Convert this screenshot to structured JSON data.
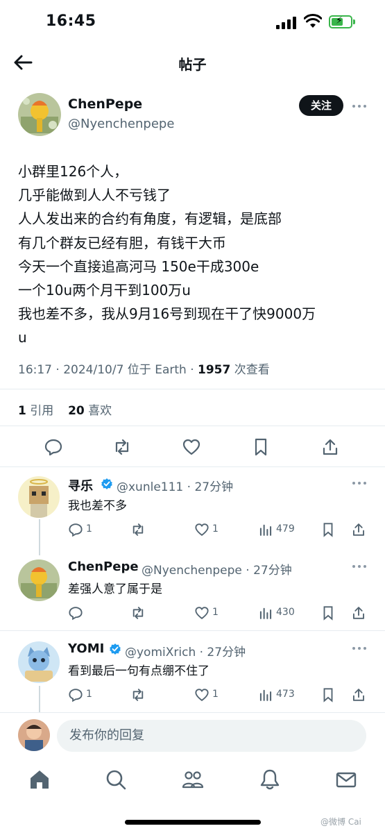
{
  "status_bar": {
    "time": "16:45"
  },
  "nav": {
    "title": "帖子"
  },
  "post": {
    "author_name": "ChenPepe",
    "author_handle": "@Nyenchenpepe",
    "follow_label": "关注",
    "lines": [
      "小群里126个人，",
      "几乎能做到人人不亏钱了",
      "人人发出来的合约有角度，有逻辑，是底部",
      "有几个群友已经有胆，有钱干大币",
      "今天一个直接追高河马 150e干成300e",
      "一个10u两个月干到100万u",
      "我也差不多，我从9月16号到现在干了快9000万",
      "u"
    ],
    "meta": {
      "time": "16:17",
      "date": "2024/10/7",
      "location": "位于 Earth",
      "views": "1957",
      "views_label": "次查看"
    },
    "stats": {
      "quotes": "1",
      "quotes_label": "引用",
      "likes": "20",
      "likes_label": "喜欢"
    }
  },
  "replies": [
    {
      "name": "寻乐",
      "verified": true,
      "handle": "@xunle111 · 27分钟",
      "text": "我也差不多",
      "replies": "1",
      "likes": "1",
      "views": "479"
    },
    {
      "name": "ChenPepe",
      "verified": false,
      "handle": "@Nyenchenpepe · 27分钟",
      "text": "差强人意了属于是",
      "replies": "",
      "likes": "1",
      "views": "430"
    },
    {
      "name": "YOMI",
      "verified": true,
      "handle": "@yomiXrich · 27分钟",
      "text": "看到最后一句有点绷不住了",
      "replies": "1",
      "likes": "1",
      "views": "473"
    }
  ],
  "compose": {
    "placeholder": "发布你的回复"
  },
  "tabs": [
    "home-icon",
    "search-icon",
    "communities-icon",
    "notifications-icon",
    "messages-icon"
  ],
  "watermark": "@微博 Cai",
  "colors": {
    "accent": "#1d9bf0",
    "text": "#0f1419",
    "muted": "#536471",
    "battery": "#39b54a"
  }
}
